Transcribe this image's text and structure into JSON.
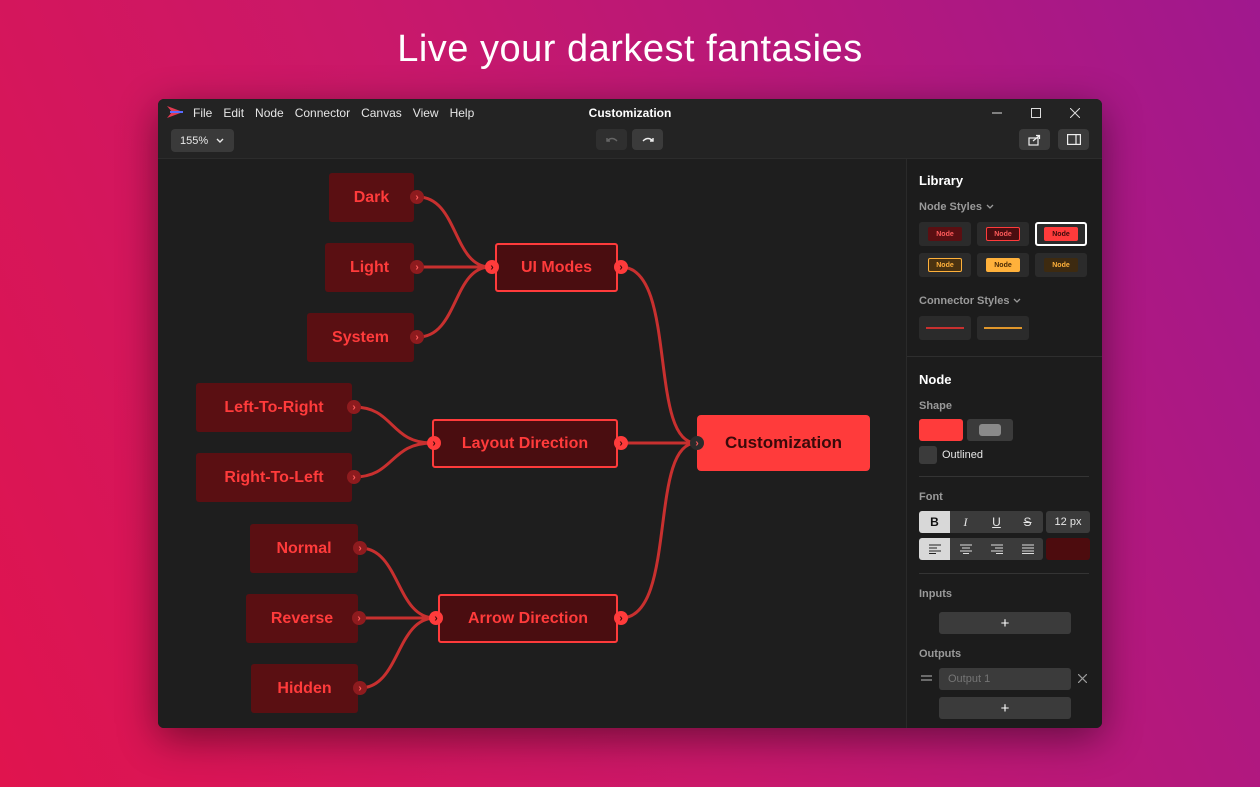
{
  "headline": "Live your darkest fantasies",
  "window": {
    "title": "Customization",
    "menu": [
      "File",
      "Edit",
      "Node",
      "Connector",
      "Canvas",
      "View",
      "Help"
    ],
    "zoom": "155%"
  },
  "canvas": {
    "nodes": {
      "dark": "Dark",
      "light": "Light",
      "system": "System",
      "ui_modes": "UI Modes",
      "ltr": "Left-To-Right",
      "rtl": "Right-To-Left",
      "layout_direction": "Layout Direction",
      "normal": "Normal",
      "reverse": "Reverse",
      "hidden": "Hidden",
      "arrow_direction": "Arrow Direction",
      "customization": "Customization"
    }
  },
  "panel": {
    "library_title": "Library",
    "node_styles_label": "Node Styles",
    "node_style_tiles": [
      "Node",
      "Node",
      "Node",
      "Node",
      "Node",
      "Node"
    ],
    "connector_styles_label": "Connector Styles",
    "node_title": "Node",
    "shape_label": "Shape",
    "outlined_label": "Outlined",
    "font_label": "Font",
    "font_buttons": [
      "B",
      "I",
      "U",
      "S"
    ],
    "font_size": "12 px",
    "inputs_label": "Inputs",
    "outputs_label": "Outputs",
    "output_placeholder": "Output 1",
    "add_symbol": "+"
  },
  "colors": {
    "accent": "#ff3b3b",
    "node_fill": "#5a0f12",
    "connector": "#c8302f",
    "orange": "#ffb13b"
  }
}
